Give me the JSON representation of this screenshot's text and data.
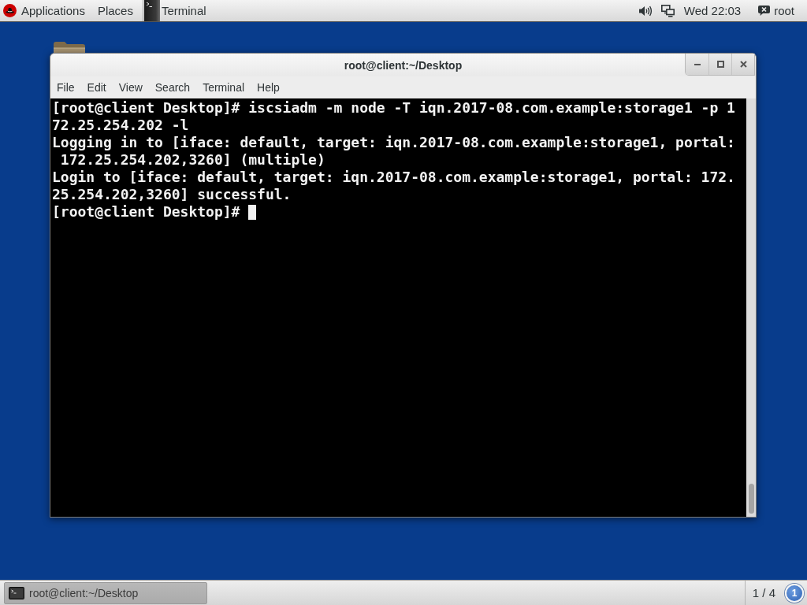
{
  "top_bar": {
    "menus": [
      {
        "label": "Applications",
        "kind": "logo"
      },
      {
        "label": "Places",
        "kind": "plain"
      }
    ],
    "app_menu": "Terminal",
    "clock": "Wed 22:03",
    "user": "root"
  },
  "window": {
    "title": "root@client:~/Desktop",
    "menu": [
      "File",
      "Edit",
      "View",
      "Search",
      "Terminal",
      "Help"
    ],
    "terminal": {
      "lines": [
        "[root@client Desktop]# iscsiadm -m node -T iqn.2017-08.com.example:storage1 -p 1",
        "72.25.254.202 -l",
        "Logging in to [iface: default, target: iqn.2017-08.com.example:storage1, portal:",
        " 172.25.254.202,3260] (multiple)",
        "Login to [iface: default, target: iqn.2017-08.com.example:storage1, portal: 172.",
        "25.254.202,3260] successful."
      ],
      "prompt": "[root@client Desktop]#",
      "cursor": true
    }
  },
  "taskbar": {
    "windows": [
      {
        "label": "root@client:~/Desktop",
        "selected": true
      }
    ],
    "workspace": "1 / 4",
    "notification_count": "1"
  }
}
